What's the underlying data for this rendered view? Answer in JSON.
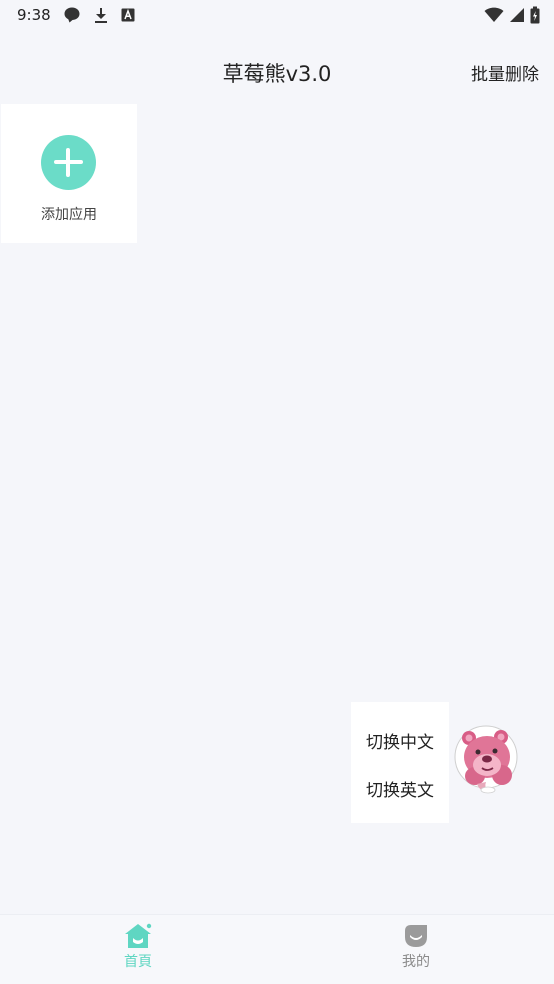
{
  "status_bar": {
    "time": "9:38",
    "left_icons": [
      "chat-bubble-icon",
      "download-icon",
      "font-a-icon"
    ],
    "right_icons": [
      "wifi-icon",
      "signal-icon",
      "battery-icon"
    ]
  },
  "header": {
    "title": "草莓熊v3.0",
    "batch_delete_label": "批量删除"
  },
  "add_app": {
    "label": "添加应用",
    "icon": "plus-circle-icon",
    "accent_color": "#6bdcc8"
  },
  "language_menu": {
    "switch_chinese": "切换中文",
    "switch_english": "切换英文"
  },
  "floating_avatar": {
    "icon": "strawberry-bear-avatar-icon"
  },
  "bottom_nav": {
    "items": [
      {
        "label": "首頁",
        "icon": "home-icon",
        "active": true,
        "color": "#5fd6c2"
      },
      {
        "label": "我的",
        "icon": "profile-icon",
        "active": false,
        "color": "#8a8a8a"
      }
    ]
  },
  "colors": {
    "background": "#f5f6fa",
    "card": "#ffffff",
    "accent": "#6bdcc8"
  }
}
